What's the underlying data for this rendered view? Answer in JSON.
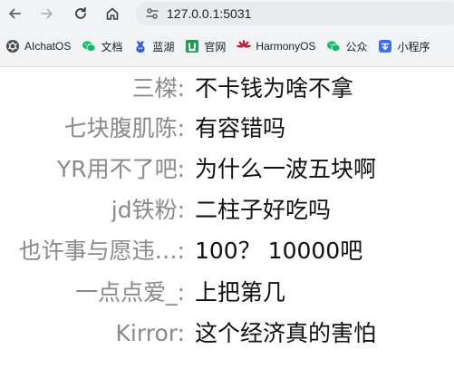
{
  "browser": {
    "url": "127.0.0.1:5031",
    "bookmarks": [
      {
        "label": "AIchatOS",
        "icon": "openai-icon"
      },
      {
        "label": "文档",
        "icon": "wechat-icon"
      },
      {
        "label": "蓝湖",
        "icon": "lanhu-icon"
      },
      {
        "label": "官网",
        "icon": "upwork-icon"
      },
      {
        "label": "HarmonyOS",
        "icon": "huawei-icon"
      },
      {
        "label": "公众",
        "icon": "wechat-icon"
      },
      {
        "label": "小程序",
        "icon": "mini-program-icon"
      }
    ],
    "colors": {
      "toolbar_bg": "#f1f3f4",
      "address_bg": "#e8eaed",
      "wechat_green": "#07c160",
      "huawei_red": "#cf0a2c",
      "lanhu_blue": "#3b5bdb",
      "upwork_green": "#1f9d55"
    }
  },
  "messages": [
    {
      "user": "三榤:",
      "text": "不卡钱为啥不拿"
    },
    {
      "user": "七块腹肌陈:",
      "text": "有容错吗"
    },
    {
      "user": "YR用不了吧:",
      "text": "为什么一波五块啊"
    },
    {
      "user": "jd铁粉:",
      "text": "二柱子好吃吗"
    },
    {
      "user": "也许事与愿违…:",
      "text": "100？ 10000吧"
    },
    {
      "user": "一点点爱_:",
      "text": "上把第几"
    },
    {
      "user": "Kirror:",
      "text": "这个经济真的害怕"
    }
  ]
}
